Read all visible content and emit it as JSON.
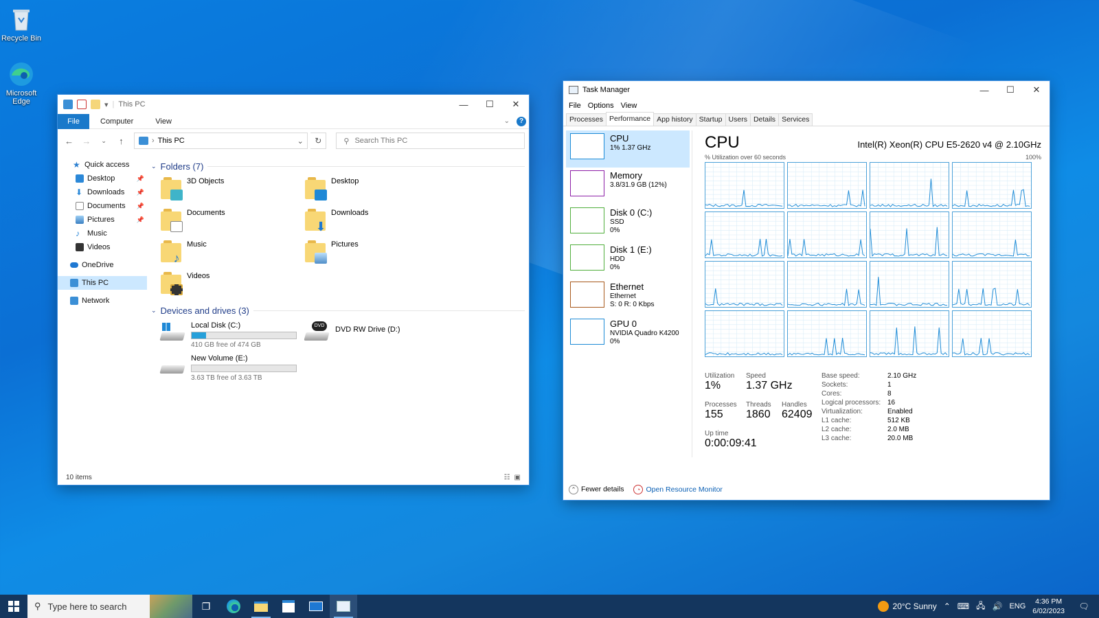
{
  "desktop": {
    "icons": [
      {
        "label": "Recycle Bin"
      },
      {
        "label": "Microsoft Edge"
      }
    ]
  },
  "explorer": {
    "title": "This PC",
    "ribbon_tabs": [
      "File",
      "Computer",
      "View"
    ],
    "address": "This PC",
    "search_placeholder": "Search This PC",
    "sidebar": [
      {
        "label": "Quick access",
        "pinned": false
      },
      {
        "label": "Desktop",
        "pinned": true
      },
      {
        "label": "Downloads",
        "pinned": true
      },
      {
        "label": "Documents",
        "pinned": true
      },
      {
        "label": "Pictures",
        "pinned": true
      },
      {
        "label": "Music",
        "pinned": false
      },
      {
        "label": "Videos",
        "pinned": false
      },
      {
        "label": "OneDrive",
        "pinned": false
      },
      {
        "label": "This PC",
        "pinned": false
      },
      {
        "label": "Network",
        "pinned": false
      }
    ],
    "folders_header": "Folders (7)",
    "folders": [
      "3D Objects",
      "Desktop",
      "Documents",
      "Downloads",
      "Music",
      "Pictures",
      "Videos"
    ],
    "drives_header": "Devices and drives (3)",
    "drives": [
      {
        "name": "Local Disk (C:)",
        "free": "410 GB free of 474 GB",
        "used_fraction": 0.135
      },
      {
        "name": "DVD RW Drive (D:)",
        "free": ""
      },
      {
        "name": "New Volume (E:)",
        "free": "3.63 TB free of 3.63 TB",
        "used_fraction": 0.0
      }
    ],
    "status": "10 items"
  },
  "taskmgr": {
    "title": "Task Manager",
    "menu": [
      "File",
      "Options",
      "View"
    ],
    "tabs": [
      "Processes",
      "Performance",
      "App history",
      "Startup",
      "Users",
      "Details",
      "Services"
    ],
    "resources": [
      {
        "name": "CPU",
        "d1": "1%  1.37 GHz",
        "d2": "",
        "d3": "",
        "color": "#1b8ad6"
      },
      {
        "name": "Memory",
        "d1": "3.8/31.9 GB (12%)",
        "d2": "",
        "d3": "",
        "color": "#8b1ca6"
      },
      {
        "name": "Disk 0 (C:)",
        "d1": "SSD",
        "d2": "0%",
        "d3": "",
        "color": "#4fae3b"
      },
      {
        "name": "Disk 1 (E:)",
        "d1": "HDD",
        "d2": "0%",
        "d3": "",
        "color": "#4fae3b"
      },
      {
        "name": "Ethernet",
        "d1": "Ethernet",
        "d2": "S: 0  R: 0 Kbps",
        "d3": "",
        "color": "#a7581a"
      },
      {
        "name": "GPU 0",
        "d1": "NVIDIA Quadro K4200",
        "d2": "0%",
        "d3": "",
        "color": "#1b8ad6"
      }
    ],
    "cpu": {
      "heading": "CPU",
      "model": "Intel(R) Xeon(R) CPU E5-2620 v4 @ 2.10GHz",
      "axis_left": "% Utilization over 60 seconds",
      "axis_right": "100%",
      "utilization_label": "Utilization",
      "utilization": "1%",
      "speed_label": "Speed",
      "speed": "1.37 GHz",
      "processes_label": "Processes",
      "processes": "155",
      "threads_label": "Threads",
      "threads": "1860",
      "handles_label": "Handles",
      "handles": "62409",
      "uptime_label": "Up time",
      "uptime": "0:00:09:41",
      "specs": [
        [
          "Base speed:",
          "2.10 GHz"
        ],
        [
          "Sockets:",
          "1"
        ],
        [
          "Cores:",
          "8"
        ],
        [
          "Logical processors:",
          "16"
        ],
        [
          "Virtualization:",
          "Enabled"
        ],
        [
          "L1 cache:",
          "512 KB"
        ],
        [
          "L2 cache:",
          "2.0 MB"
        ],
        [
          "L3 cache:",
          "20.0 MB"
        ]
      ]
    },
    "fewer_details": "Fewer details",
    "resource_monitor": "Open Resource Monitor"
  },
  "taskbar": {
    "search_placeholder": "Type here to search",
    "weather": "20°C  Sunny",
    "language": "ENG",
    "time": "4:36 PM",
    "date": "6/02/2023"
  }
}
